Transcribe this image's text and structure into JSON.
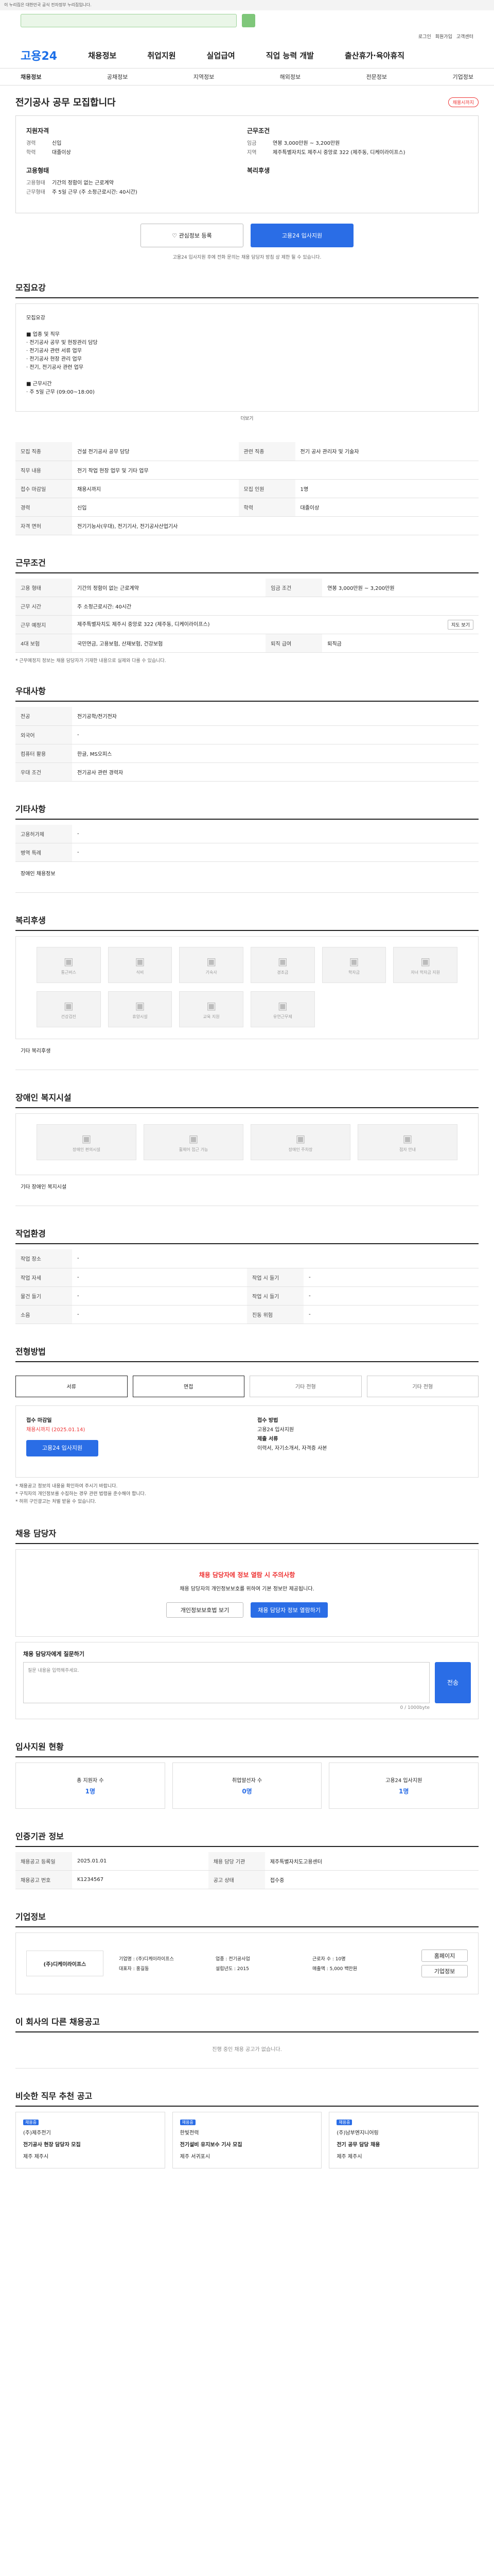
{
  "gov_banner": "이 누리집은 대한민국 공식 전자정부 누리집입니다.",
  "utility": [
    "로그인",
    "회원가입",
    "고객센터"
  ],
  "logo": "고용24",
  "gnb": [
    "채용정보",
    "취업지원",
    "실업급여",
    "직업 능력 개발",
    "출산휴가·육아휴직"
  ],
  "lnb": [
    "채용정보",
    "공채정보",
    "지역정보",
    "해외정보",
    "전문정보",
    "기업정보"
  ],
  "title": "전기공사 공무 모집합니다",
  "title_tag": "채용시까지",
  "summary": {
    "req_title": "지원자격",
    "req": [
      [
        "경력",
        "신입"
      ],
      [
        "학력",
        "대졸이상"
      ]
    ],
    "cond_title": "근무조건",
    "cond": [
      [
        "임금",
        "연봉 3,000만원 ~ 3,200만원"
      ],
      [
        "지역",
        "제주특별자치도 제주시 중앙로 322 (제주동, 디케이라이프스)"
      ]
    ],
    "corp_title": "고용형태",
    "corp": [
      [
        "고용형태",
        "기간의 정함이 없는 근로계약"
      ],
      [
        "근무형태",
        "주 5일 근무 (주 소정근로시간: 40시간)"
      ]
    ],
    "welfare_title": "복리후생"
  },
  "buttons": {
    "scrap": "관심정보 등록",
    "apply": "고용24 입사지원"
  },
  "apply_note": "고용24 입사지원 후에 전화 문의는 채용 담당자 방침 상 제한 될 수 있습니다.",
  "detail": {
    "h": "모집요강",
    "text": "모집요강\n\n■ 업종 및 직무\n · 전기공사 공무 및 현장관리 담당\n · 전기공사 관련 서류 업무\n · 전기공사 현장 관리 업무\n · 전기, 전기공사 관련 업무\n\n■ 근무시간\n · 주 5일 근무 (09:00~18:00)",
    "more": "더보기"
  },
  "job_info": {
    "h": "모집요강",
    "rows": [
      [
        "모집 직종",
        "건설 전기공사 공무 담당",
        "관련 직종",
        "전기 공사 관리자 및 기술자"
      ],
      [
        "직무 내용",
        "전기 작업 현장 업무 및 기타 업무",
        "",
        ""
      ],
      [
        "접수 마감일",
        "채용시까지",
        "모집 인원",
        "1명"
      ],
      [
        "경력",
        "신입",
        "학력",
        "대졸이상"
      ],
      [
        "자격 면허",
        "전기기능사(우대), 전기기사, 전기공사산업기사",
        "",
        ""
      ]
    ]
  },
  "work": {
    "h": "근무조건",
    "rows": [
      [
        "고용 형태",
        "기간의 정함이 없는 근로계약",
        "임금 조건",
        "연봉 3,000만원 ~ 3,200만원"
      ],
      [
        "근무 시간",
        "주 소정근로시간: 40시간",
        "",
        ""
      ],
      [
        "근무 예정지",
        "제주특별자치도 제주시 중앙로 322 (제주동, 디케이라이프스)",
        "",
        ""
      ],
      [
        "4대 보험",
        "국민연금, 고용보험, 산재보험, 건강보험",
        "퇴직 급여",
        "퇴직금"
      ]
    ],
    "note": "* 근무예정지 정보는 채용 담당자가 기재한 내용으로 실제와 다를 수 있습니다.",
    "map_btn": "지도 보기"
  },
  "prefer": {
    "h": "우대사항",
    "rows": [
      [
        "전공",
        "전기공학/전기전자"
      ],
      [
        "외국어",
        "-"
      ],
      [
        "컴퓨터 활용",
        "한글, MS오피스"
      ],
      [
        "우대 조건",
        "전기공사 관련 경력자"
      ]
    ]
  },
  "other": {
    "h": "기타사항",
    "rows": [
      [
        "고용허가제",
        "-"
      ],
      [
        "병역 특례",
        "-"
      ]
    ],
    "link": "장애인 채용정보"
  },
  "welfare": {
    "h": "복리후생",
    "icons": [
      "통근버스",
      "식비",
      "기숙사",
      "경조금",
      "학자금",
      "자녀 학자금 지원",
      "건강검진",
      "휴양시설",
      "교육 지원",
      "유연근무제"
    ],
    "empty": "기타 복리후생"
  },
  "disabled": {
    "h": "장애인 복지시설",
    "icons": [
      "장애인 편의시설",
      "휠체어 접근 가능",
      "장애인 주차장",
      "점자 안내"
    ],
    "empty": "기타 장애인 복지시설"
  },
  "environment": {
    "h": "작업환경",
    "rows": [
      [
        "작업 장소",
        "-",
        "",
        ""
      ],
      [
        "작업 자세",
        "-",
        "작업 시 들기",
        "-"
      ],
      [
        "물건 들기",
        "-",
        "작업 시 들기",
        "-"
      ],
      [
        "소음",
        "-",
        "진동 위험",
        "-"
      ]
    ]
  },
  "method": {
    "h": "전형방법",
    "steps": [
      "서류",
      "면접",
      "기타 전형",
      "기타 전형"
    ]
  },
  "apply": {
    "h": "접수방법",
    "deadline_label": "접수 마감일",
    "deadline": "채용시까지 (2025.01.14)",
    "way_label": "접수 방법",
    "way": "고용24 입사지원",
    "doc_label": "제출 서류",
    "doc": "이력서, 자기소개서, 자격증 사본",
    "apply_btn": "고용24 입사지원"
  },
  "apply_notes": [
    "* 채용공고 정보의 내용을 확인하여 주시기 바랍니다.",
    "* 구직자의 개인정보를 수집하는 경우 관련 법령을 준수해야 합니다.",
    "* 허위 구인광고는 처벌 받을 수 있습니다."
  ],
  "manager": {
    "h": "채용 담당자",
    "alert": "채용 담당자에 정보 열람 시 주의사항",
    "desc": "채용 담당자의 개인정보보호를 위하여 기본 정보만 제공됩니다.",
    "btn1": "개인정보보호법 보기",
    "btn2": "채용 담당자 정보 열람하기"
  },
  "qna": {
    "h": "채용 담당자에게 질문하기",
    "placeholder": "질문 내용을 입력해주세요.",
    "count": "0 / 1000byte",
    "send": "전송"
  },
  "stats": {
    "h": "입사지원 현황",
    "items": [
      [
        "총 지원자 수",
        "1명"
      ],
      [
        "취업알선자 수",
        "0명"
      ],
      [
        "고용24 입사지원",
        "1명"
      ]
    ]
  },
  "register": {
    "h": "인증기관 정보",
    "rows": [
      [
        "채용공고 등록일",
        "2025.01.01",
        "채용 담당 기관",
        "제주특별자치도고용센터"
      ],
      [
        "채용공고 번호",
        "K1234567",
        "공고 상태",
        "접수중"
      ]
    ]
  },
  "company": {
    "h": "기업정보",
    "name": "(주)디케이라이프스",
    "info": [
      [
        "기업명",
        "(주)디케이라이프스"
      ],
      [
        "업종",
        "전기공사업"
      ],
      [
        "근로자 수",
        "10명"
      ],
      [
        "대표자",
        "홍길동"
      ],
      [
        "설립년도",
        "2015"
      ],
      [
        "매출액",
        "5,000 백만원"
      ]
    ],
    "b1": "홈페이지",
    "b2": "기업정보"
  },
  "similar": {
    "h": "이 회사의 다른 채용공고",
    "empty": "진행 중인 채용 공고가 없습니다."
  },
  "recommend": {
    "h": "비슷한 직무 추천 공고",
    "cards": [
      [
        "채용중",
        "(주)제주전기",
        "전기공사 현장 담당자 모집",
        "제주 제주시"
      ],
      [
        "채용중",
        "한빛전력",
        "전기설비 유지보수 기사 모집",
        "제주 서귀포시"
      ],
      [
        "채용중",
        "(주)남부엔지니어링",
        "전기 공무 담당 채용",
        "제주 제주시"
      ]
    ]
  }
}
